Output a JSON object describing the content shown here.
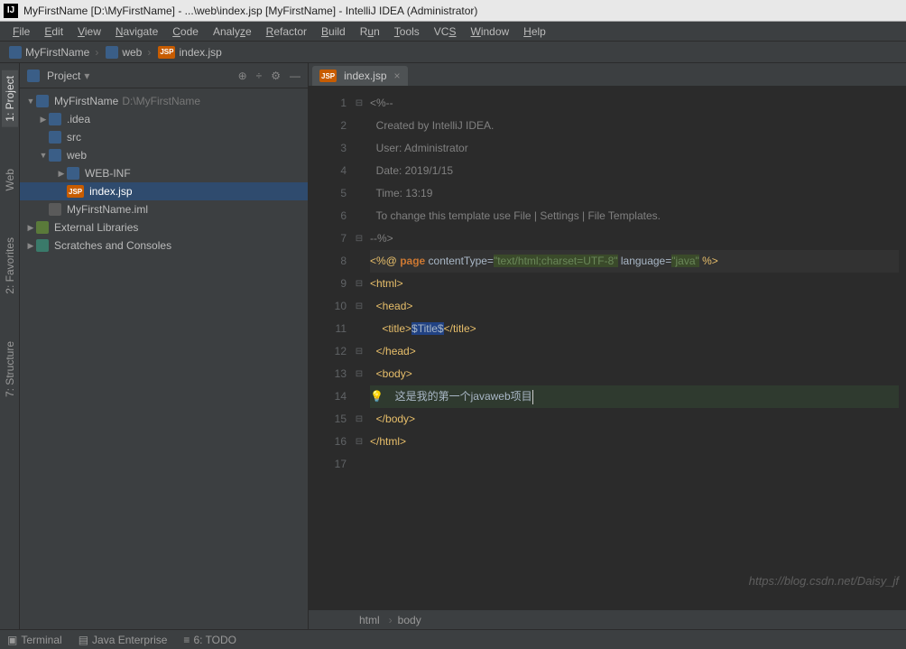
{
  "title": "MyFirstName [D:\\MyFirstName] - ...\\web\\index.jsp [MyFirstName] - IntelliJ IDEA (Administrator)",
  "menu": [
    "File",
    "Edit",
    "View",
    "Navigate",
    "Code",
    "Analyze",
    "Refactor",
    "Build",
    "Run",
    "Tools",
    "VCS",
    "Window",
    "Help"
  ],
  "crumbs": [
    {
      "icon": "proj",
      "label": "MyFirstName"
    },
    {
      "icon": "folder",
      "label": "web"
    },
    {
      "icon": "jsp",
      "label": "index.jsp"
    }
  ],
  "left_tabs": [
    {
      "label": "1: Project",
      "active": true
    },
    {
      "label": "Web",
      "active": false
    },
    {
      "label": "2: Favorites",
      "active": false
    },
    {
      "label": "7: Structure",
      "active": false
    }
  ],
  "sidebar": {
    "title": "Project",
    "tools": [
      "target-icon",
      "split-icon",
      "gear-icon",
      "minimize-icon"
    ]
  },
  "tree": [
    {
      "d": 0,
      "arr": "▼",
      "icon": "proj",
      "label": "MyFirstName",
      "path": "D:\\MyFirstName"
    },
    {
      "d": 1,
      "arr": "▶",
      "icon": "folder",
      "label": ".idea"
    },
    {
      "d": 1,
      "arr": " ",
      "icon": "folder",
      "label": "src"
    },
    {
      "d": 1,
      "arr": "▼",
      "icon": "folder",
      "label": "web"
    },
    {
      "d": 2,
      "arr": "▶",
      "icon": "folder",
      "label": "WEB-INF"
    },
    {
      "d": 2,
      "arr": " ",
      "icon": "jsp",
      "label": "index.jsp",
      "sel": true
    },
    {
      "d": 1,
      "arr": " ",
      "icon": "file",
      "label": "MyFirstName.iml"
    },
    {
      "d": 0,
      "arr": "▶",
      "icon": "lib",
      "label": "External Libraries"
    },
    {
      "d": 0,
      "arr": "▶",
      "icon": "scr",
      "label": "Scratches and Consoles"
    }
  ],
  "editor_tab": {
    "icon": "jsp",
    "label": "index.jsp"
  },
  "code": {
    "l1": "<%--",
    "l2": "  Created by IntelliJ IDEA.",
    "l3": "  User: Administrator",
    "l4": "  Date: 2019/1/15",
    "l5": "  Time: 13:19",
    "l6": "  To change this template use File | Settings | File Templates.",
    "l7": "--%>",
    "l8_a": "<%@ ",
    "l8_kw": "page",
    "l8_b": " contentType=",
    "l8_s1": "\"text/html;charset=UTF-8\"",
    "l8_c": " language=",
    "l8_s2": "\"java\"",
    "l8_d": " %>",
    "l9": "<html>",
    "l10": "<head>",
    "l11_a": "    <title>",
    "l11_b": "$Title$",
    "l11_c": "</title>",
    "l12": "</head>",
    "l13": "<body>",
    "l14": "  这是我的第一个javaweb项目",
    "l15": "</body>",
    "l16": "</html>",
    "l17": ""
  },
  "line_count": 17,
  "crumb_path": [
    "html",
    "body"
  ],
  "status": {
    "items": [
      {
        "icon": "terminal-icon",
        "label": "Terminal"
      },
      {
        "icon": "ee-icon",
        "label": "Java Enterprise"
      },
      {
        "icon": "todo-icon",
        "label": "6: TODO"
      }
    ]
  },
  "watermark": "https://blog.csdn.net/Daisy_jf"
}
